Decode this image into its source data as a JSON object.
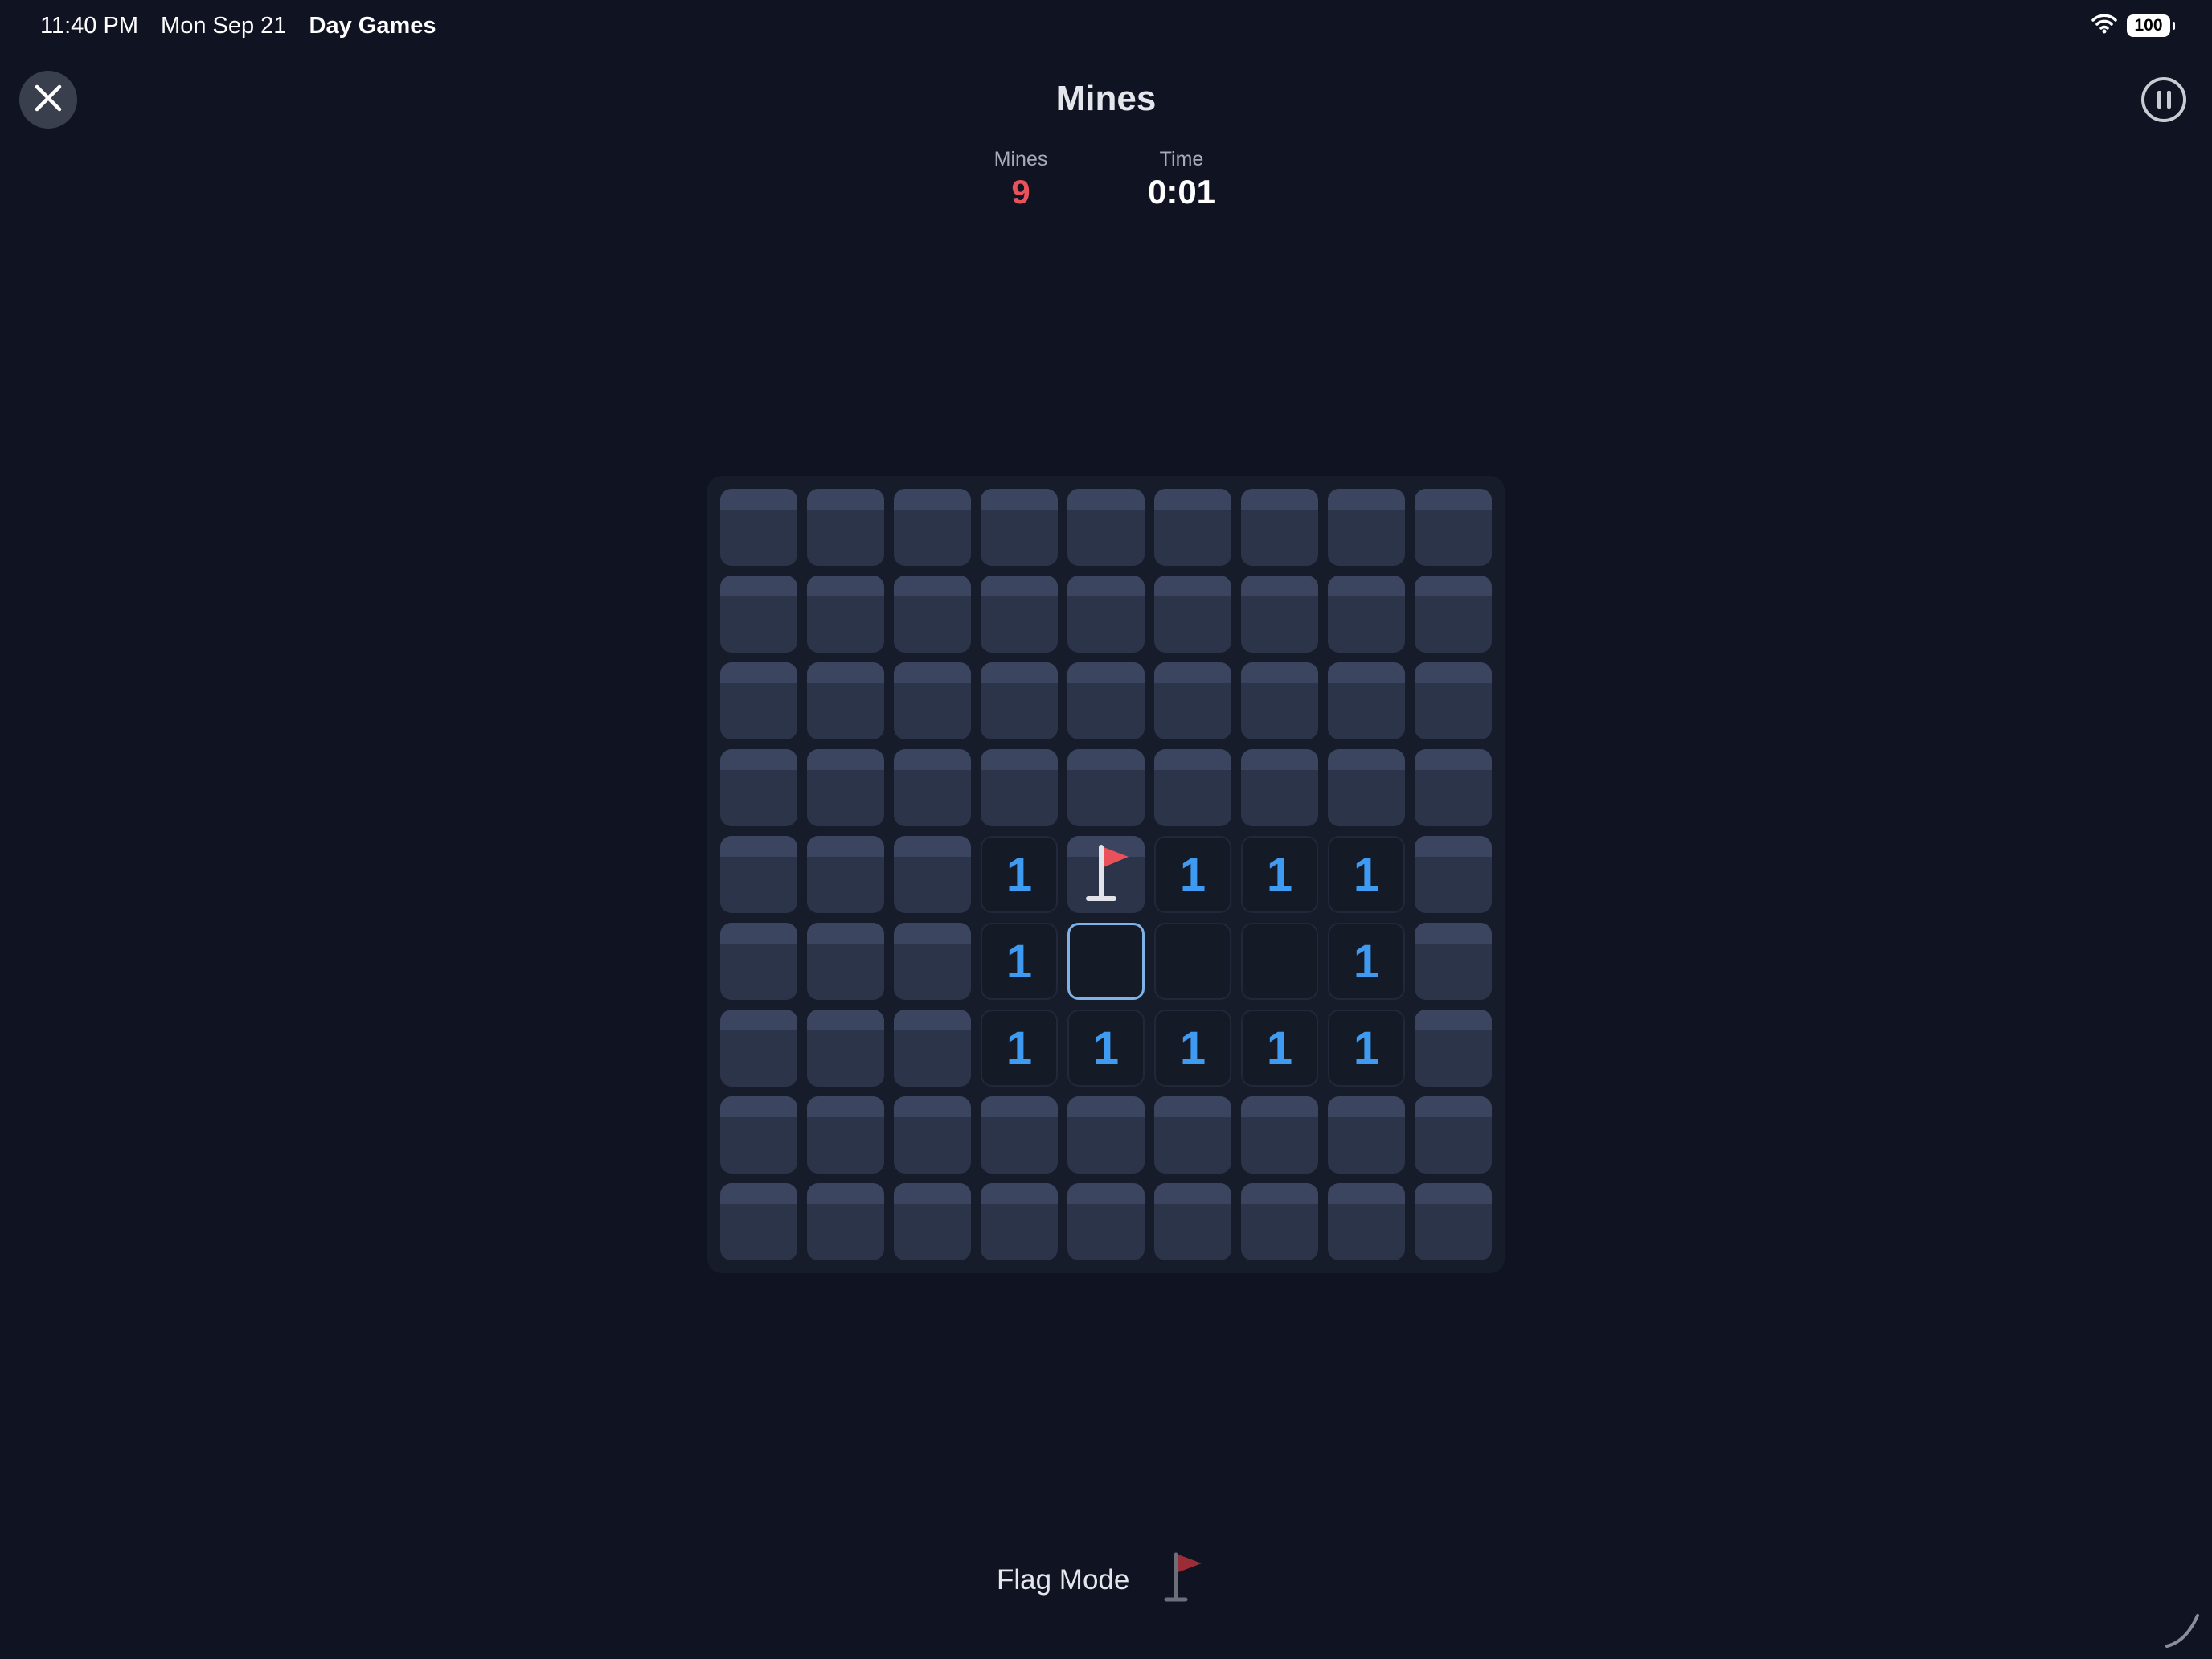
{
  "status_bar": {
    "time": "11:40 PM",
    "date": "Mon Sep 21",
    "app_name": "Day Games",
    "battery": "100",
    "wifi_icon": "wifi-icon"
  },
  "header": {
    "title": "Mines",
    "close_icon": "close-icon",
    "pause_icon": "pause-icon"
  },
  "stats": {
    "mines_label": "Mines",
    "mines_value": "9",
    "time_label": "Time",
    "time_value": "0:01"
  },
  "board": {
    "rows": 9,
    "cols": 9,
    "grid": [
      [
        "H",
        "H",
        "H",
        "H",
        "H",
        "H",
        "H",
        "H",
        "H"
      ],
      [
        "H",
        "H",
        "H",
        "H",
        "H",
        "H",
        "H",
        "H",
        "H"
      ],
      [
        "H",
        "H",
        "H",
        "H",
        "H",
        "H",
        "H",
        "H",
        "H"
      ],
      [
        "H",
        "H",
        "H",
        "H",
        "H",
        "H",
        "H",
        "H",
        "H"
      ],
      [
        "H",
        "H",
        "H",
        "1",
        "F",
        "1",
        "1",
        "1",
        "H"
      ],
      [
        "H",
        "H",
        "H",
        "1",
        "S",
        "0",
        "0",
        "1",
        "H"
      ],
      [
        "H",
        "H",
        "H",
        "1",
        "1",
        "1",
        "1",
        "1",
        "H"
      ],
      [
        "H",
        "H",
        "H",
        "H",
        "H",
        "H",
        "H",
        "H",
        "H"
      ],
      [
        "H",
        "H",
        "H",
        "H",
        "H",
        "H",
        "H",
        "H",
        "H"
      ]
    ],
    "legend": {
      "H": "covered",
      "F": "flagged",
      "S": "selected-revealed-empty",
      "0": "revealed-empty",
      "1": "revealed-number"
    },
    "number_color": "#3f9bf2",
    "flag_color": "#e9525a"
  },
  "footer": {
    "flag_mode_label": "Flag Mode",
    "flag_mode_icon": "flag-icon",
    "flag_mode_enabled": false
  },
  "colors": {
    "background": "#101422",
    "mines_count": "#e9525a",
    "selected_outline": "#7fb3e8"
  }
}
